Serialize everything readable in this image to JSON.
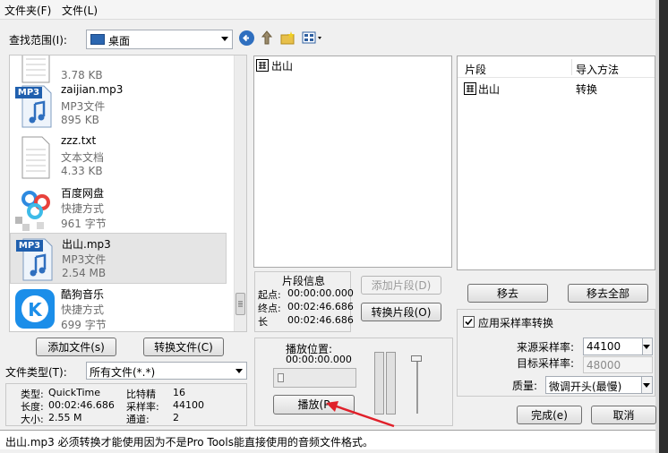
{
  "menu": {
    "folder": "文件夹(F)",
    "file": "文件(L)"
  },
  "lookin": {
    "label": "查找范围(I):",
    "value": "桌面"
  },
  "files": [
    {
      "name": "",
      "type": "",
      "size": "3.78 KB",
      "icon": "document-icon"
    },
    {
      "name": "zaijian.mp3",
      "type": "MP3文件",
      "size": "895 KB",
      "icon": "mp3-icon"
    },
    {
      "name": "zzz.txt",
      "type": "文本文档",
      "size": "4.33 KB",
      "icon": "text-document-icon"
    },
    {
      "name": "百度网盘",
      "type": "快捷方式",
      "size": "961 字节",
      "icon": "baidu-netdisk-icon"
    },
    {
      "name": "出山.mp3",
      "type": "MP3文件",
      "size": "2.54 MB",
      "icon": "mp3-icon"
    },
    {
      "name": "酷狗音乐",
      "type": "快捷方式",
      "size": "699 字节",
      "icon": "kugou-music-icon"
    }
  ],
  "mp3_badge": "MP3",
  "buttons": {
    "add_file": "添加文件(s)",
    "convert_file": "转换文件(C)",
    "add_segment": "添加片段(D)",
    "convert_segment": "转换片段(O)",
    "play": "播放(P",
    "remove": "移去",
    "remove_all": "移去全部",
    "done": "完成(e)",
    "cancel": "取消"
  },
  "filetype": {
    "label": "文件类型(T):",
    "value": "所有文件(*.*)"
  },
  "info": {
    "type_label": "类型:",
    "type_value": "QuickTime",
    "length_label": "长度:",
    "length_value": "00:02:46.686",
    "size_label": "大小:",
    "size_value": "2.55 M",
    "bitdepth_label": "比特精",
    "bitdepth_value": "16",
    "samplerate_label": "采样率:",
    "samplerate_value": "44100",
    "channels_label": "通道:",
    "channels_value": "2"
  },
  "segments_list": [
    "出山"
  ],
  "segment_info": {
    "title": "片段信息",
    "start_label": "起点:",
    "start_value": "00:00:00.000",
    "end_label": "终点:",
    "end_value": "00:02:46.686",
    "length_label": "长",
    "length_value": "00:02:46.686"
  },
  "playback": {
    "label": "播放位置:",
    "value": "00:00:00.000"
  },
  "import_table": {
    "col_segment": "片段",
    "col_method": "导入方法",
    "rows": [
      {
        "segment": "出山",
        "method": "转换"
      }
    ]
  },
  "sample_rate": {
    "checkbox_label": "应用采样率转换",
    "checked": true,
    "source_label": "来源采样率:",
    "source_value": "44100",
    "target_label": "目标采样率:",
    "target_value": "48000",
    "quality_label": "质量:",
    "quality_value": "微调开头(最慢)"
  },
  "status": "出山.mp3 必须转换才能使用因为不是Pro Tools能直接使用的音频文件格式。"
}
